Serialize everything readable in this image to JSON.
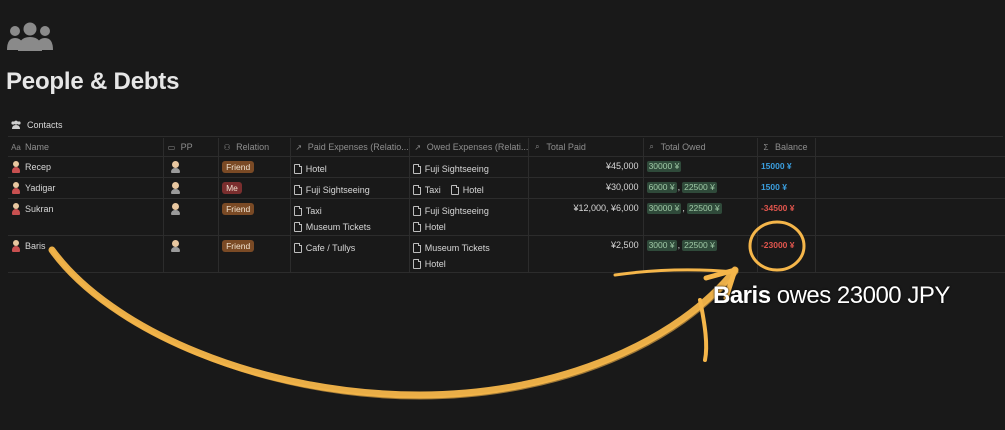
{
  "page": {
    "icon": "people-group-icon",
    "title": "People & Debts",
    "view": {
      "icon": "people-group-icon",
      "label": "Contacts"
    }
  },
  "columns": [
    {
      "key": "name",
      "icon": "Aa",
      "label": "Name"
    },
    {
      "key": "pp",
      "icon": "file-icon",
      "label": "PP"
    },
    {
      "key": "relation",
      "icon": "people-icon",
      "label": "Relation"
    },
    {
      "key": "paid",
      "icon": "↗",
      "label": "Paid Expenses (Relatio..."
    },
    {
      "key": "owed",
      "icon": "↗",
      "label": "Owed Expenses (Relati..."
    },
    {
      "key": "total_paid",
      "icon": "search-icon",
      "label": "Total Paid"
    },
    {
      "key": "total_owed",
      "icon": "search-icon",
      "label": "Total Owed"
    },
    {
      "key": "balance",
      "icon": "formula-icon",
      "label": "Balance"
    }
  ],
  "rows": [
    {
      "name": "Recep",
      "relation": "Friend",
      "paid": [
        "Hotel"
      ],
      "owed": [
        "Fuji Sightseeing"
      ],
      "owed_inline": false,
      "total_paid": "¥45,000",
      "total_owed": [
        "30000 ¥"
      ],
      "total_owed_sep": "",
      "balance": "15000 ¥"
    },
    {
      "name": "Yadigar",
      "relation": "Me",
      "paid": [
        "Fuji Sightseeing"
      ],
      "owed": [
        "Taxi",
        "Hotel"
      ],
      "owed_inline": true,
      "total_paid": "¥30,000",
      "total_owed": [
        "6000 ¥",
        "22500 ¥"
      ],
      "total_owed_sep": ",",
      "balance": "1500 ¥"
    },
    {
      "name": "Sukran",
      "relation": "Friend",
      "paid": [
        "Taxi",
        "Museum Tickets"
      ],
      "owed": [
        "Fuji Sightseeing",
        "Hotel"
      ],
      "owed_inline": false,
      "total_paid": "¥12,000, ¥6,000",
      "total_owed": [
        "30000 ¥",
        "22500 ¥"
      ],
      "total_owed_sep": ",",
      "balance": "-34500 ¥"
    },
    {
      "name": "Baris",
      "relation": "Friend",
      "paid": [
        "Cafe / Tullys"
      ],
      "owed": [
        "Museum Tickets",
        "Hotel"
      ],
      "owed_inline": false,
      "total_paid": "¥2,500",
      "total_owed": [
        "3000 ¥",
        "22500 ¥"
      ],
      "total_owed_sep": ",",
      "balance": "-23000 ¥"
    }
  ],
  "annotation": {
    "caption_name": "Baris",
    "caption_rest": " owes 23000 JPY"
  },
  "colors": {
    "background": "#191919",
    "tag_friend": "#7a4a25",
    "tag_me": "#7a2e2e",
    "balance_positive": "#3b9ede",
    "balance_negative": "#e0554d",
    "annotation": "#f5b64a"
  }
}
